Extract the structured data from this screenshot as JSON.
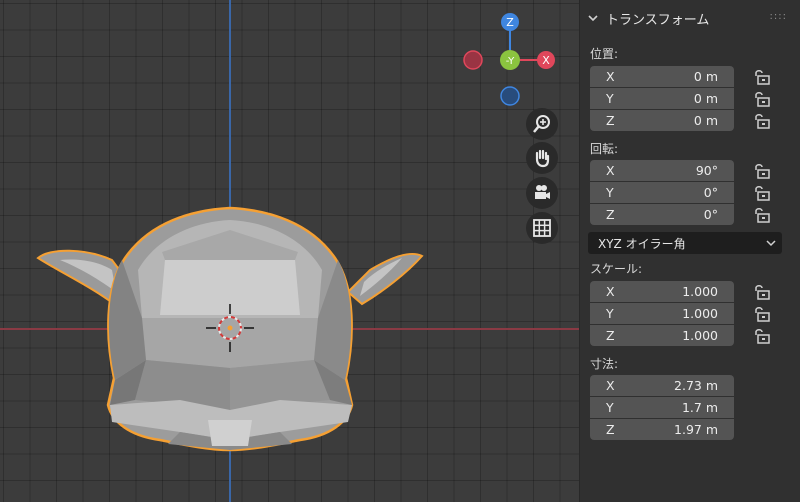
{
  "gizmo": {
    "z": "Z",
    "y": "-Y",
    "x": "X"
  },
  "panel": {
    "title": "トランスフォーム",
    "grip": "::::",
    "location": {
      "label": "位置:",
      "rows": [
        {
          "axis": "X",
          "value": "0 m"
        },
        {
          "axis": "Y",
          "value": "0 m"
        },
        {
          "axis": "Z",
          "value": "0 m"
        }
      ]
    },
    "rotation": {
      "label": "回転:",
      "rows": [
        {
          "axis": "X",
          "value": "90°"
        },
        {
          "axis": "Y",
          "value": "0°"
        },
        {
          "axis": "Z",
          "value": "0°"
        }
      ],
      "mode": "XYZ オイラー角"
    },
    "scale": {
      "label": "スケール:",
      "rows": [
        {
          "axis": "X",
          "value": "1.000"
        },
        {
          "axis": "Y",
          "value": "1.000"
        },
        {
          "axis": "Z",
          "value": "1.000"
        }
      ]
    },
    "dimensions": {
      "label": "寸法:",
      "rows": [
        {
          "axis": "X",
          "value": "2.73 m"
        },
        {
          "axis": "Y",
          "value": "1.7 m"
        },
        {
          "axis": "Z",
          "value": "1.97 m"
        }
      ]
    }
  },
  "colors": {
    "selection_outline": "#f5a033",
    "axis_x": "#e0475b",
    "axis_y": "#8bc43f",
    "axis_z": "#3f86e0"
  },
  "icons": [
    "zoom-icon",
    "hand-pan-icon",
    "camera-icon",
    "grid-ortho-icon",
    "lock-icon",
    "chevron-down-icon"
  ]
}
